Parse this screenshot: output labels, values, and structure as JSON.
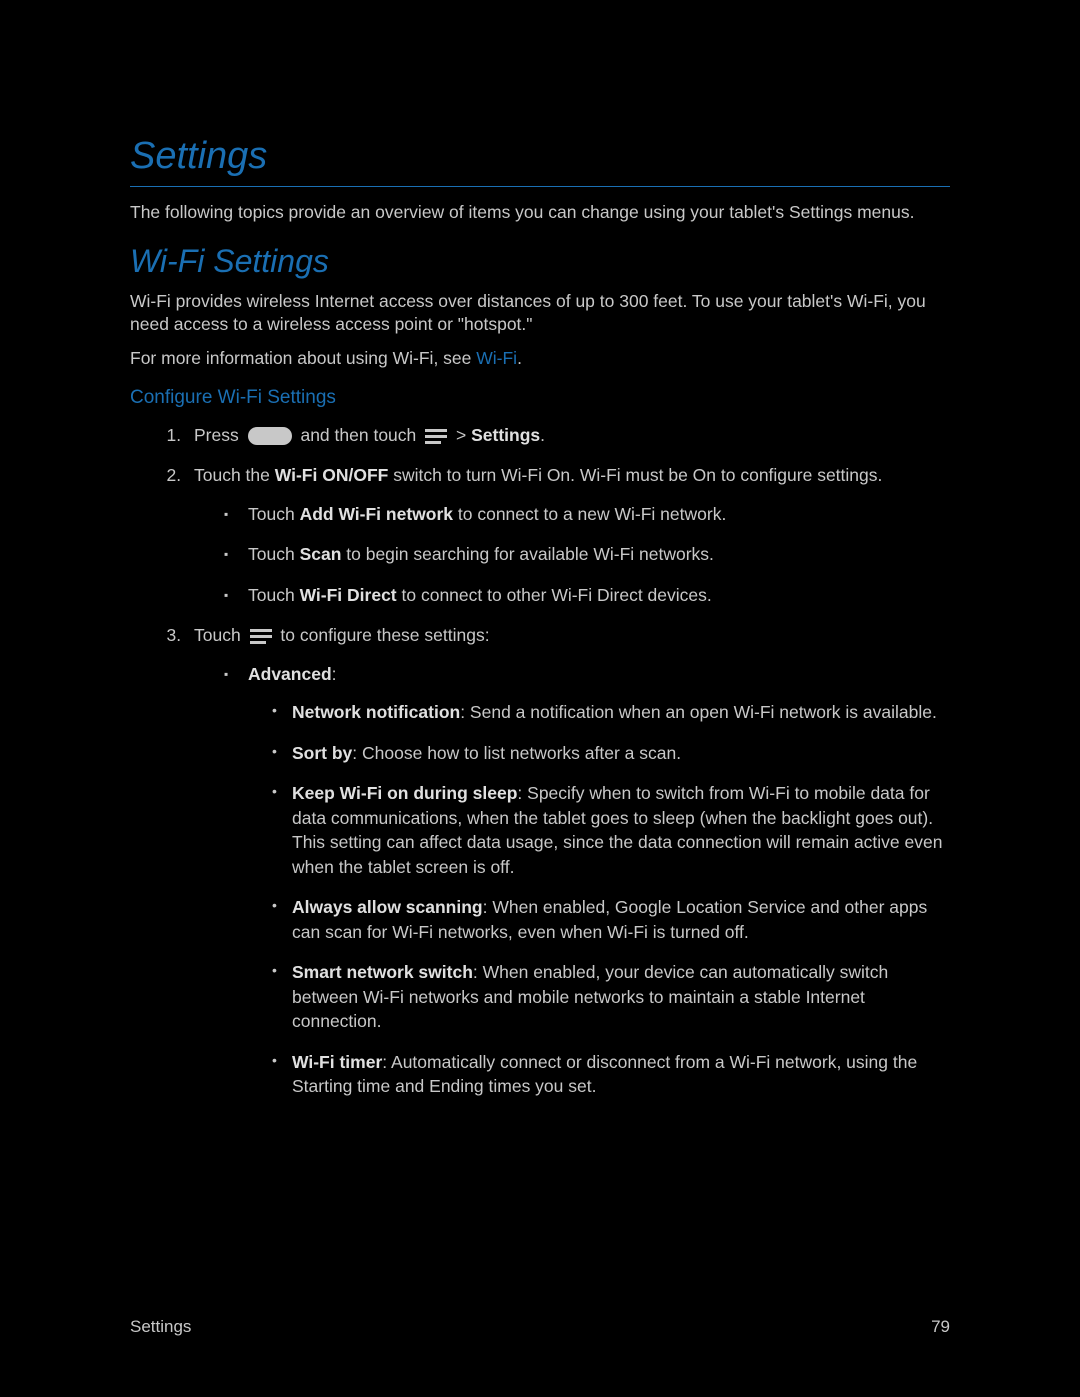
{
  "h1": "Settings",
  "intro": "The following topics provide an overview of items you can change using your tablet's Settings menus.",
  "h2": "Wi-Fi Settings",
  "wifi_intro": "Wi-Fi provides wireless Internet access over distances of up to 300 feet. To use your tablet's Wi-Fi, you need access to a wireless access point or \"hotspot.\"",
  "wifi_more_pre": "For more information about using Wi-Fi, see ",
  "wifi_more_link": "Wi-Fi",
  "wifi_more_post": ".",
  "h3": "Configure Wi-Fi Settings",
  "step1_pre": "Press ",
  "step1_mid": " and then touch ",
  "step1_gt": " > ",
  "step1_settings": "Settings",
  "step1_post": ".",
  "step2_pre": "Touch the ",
  "step2_bold": "Wi-Fi ON/OFF",
  "step2_post": " switch to turn Wi-Fi On. Wi-Fi must be On to configure settings.",
  "b1_pre": "Touch ",
  "b1_bold": "Add Wi-Fi network",
  "b1_post": " to connect to a new Wi-Fi network.",
  "b2_pre": "Touch ",
  "b2_bold": "Scan",
  "b2_post": " to begin searching for available Wi-Fi networks.",
  "b3_pre": "Touch ",
  "b3_bold": "Wi-Fi Direct",
  "b3_post": " to connect to other Wi-Fi Direct devices.",
  "step3_pre": "Touch ",
  "step3_post": " to configure these settings:",
  "adv_label": "Advanced",
  "adv_colon": ":",
  "s1_bold": "Network notification",
  "s1_post": ": Send a notification when an open Wi-Fi network is available.",
  "s2_bold": "Sort by",
  "s2_post": ": Choose how to list networks after a scan.",
  "s3_bold": "Keep Wi-Fi on during sleep",
  "s3_post": ": Specify when to switch from Wi-Fi to mobile data for data communications, when the tablet goes to sleep (when the backlight goes out). This setting can affect data usage, since the data connection will remain active even when the tablet screen is off.",
  "s4_bold": "Always allow scanning",
  "s4_post": ": When enabled, Google Location Service and other apps can scan for Wi-Fi networks, even when Wi-Fi is turned off.",
  "s5_bold": "Smart network switch",
  "s5_post": ": When enabled, your device can automatically switch between Wi-Fi networks and mobile networks to maintain a stable Internet connection.",
  "s6_bold": "Wi-Fi timer",
  "s6_post": ": Automatically connect or disconnect from a Wi-Fi network, using the Starting time and Ending times you set.",
  "footer_left": "Settings",
  "footer_right": "79"
}
